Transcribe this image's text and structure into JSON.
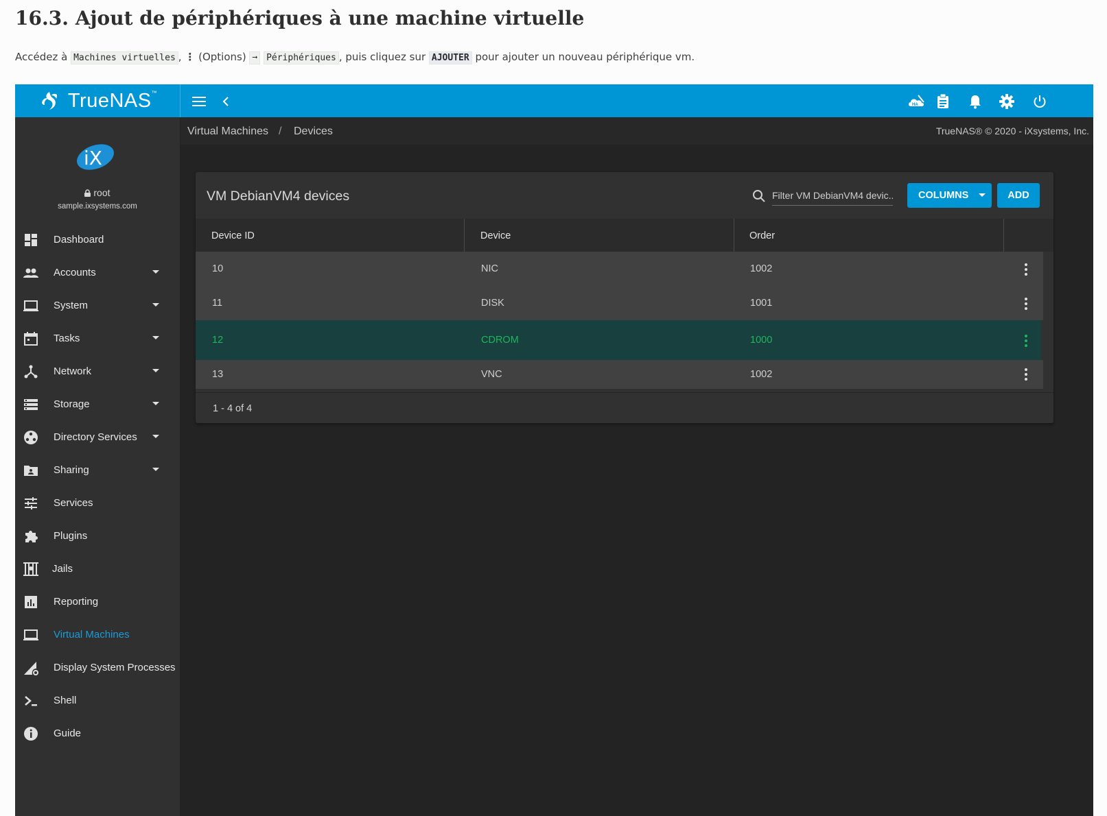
{
  "doc": {
    "heading": "16.3. Ajout de périphériques à une machine virtuelle",
    "p_prefix": "Accédez à ",
    "p_code1": "Machines virtuelles",
    "p_comma": ", ",
    "p_dots": "⋮",
    "p_options": " (Options) ",
    "p_arrow": "➞",
    "p_code2": "Périphériques",
    "p_mid": ", puis cliquez sur ",
    "p_code3": "AJOUTER",
    "p_suffix": " pour ajouter un nouveau périphérique vm."
  },
  "topbar": {
    "brand": "TrueNAS",
    "brand_tm": "™",
    "accent": "#0095d5"
  },
  "profile": {
    "user": "root",
    "host": "sample.ixsystems.com"
  },
  "nav": [
    {
      "label": "Dashboard",
      "icon": "dashboard-icon",
      "caret": false
    },
    {
      "label": "Accounts",
      "icon": "accounts-icon",
      "caret": true
    },
    {
      "label": "System",
      "icon": "system-icon",
      "caret": true
    },
    {
      "label": "Tasks",
      "icon": "tasks-icon",
      "caret": true
    },
    {
      "label": "Network",
      "icon": "network-icon",
      "caret": true
    },
    {
      "label": "Storage",
      "icon": "storage-icon",
      "caret": true
    },
    {
      "label": "Directory Services",
      "icon": "directory-services-icon",
      "caret": true
    },
    {
      "label": "Sharing",
      "icon": "sharing-icon",
      "caret": true
    },
    {
      "label": "Services",
      "icon": "services-icon",
      "caret": false
    },
    {
      "label": "Plugins",
      "icon": "plugins-icon",
      "caret": false
    },
    {
      "label": "Jails",
      "icon": "jails-icon",
      "caret": false
    },
    {
      "label": "Reporting",
      "icon": "reporting-icon",
      "caret": false
    },
    {
      "label": "Virtual Machines",
      "icon": "virtual-machines-icon",
      "caret": false,
      "active": true
    },
    {
      "label": "Display System Processes",
      "icon": "processes-icon",
      "caret": false
    },
    {
      "label": "Shell",
      "icon": "shell-icon",
      "caret": false
    },
    {
      "label": "Guide",
      "icon": "guide-icon",
      "caret": false
    }
  ],
  "breadcrumb": {
    "items": [
      "Virtual Machines",
      "Devices"
    ],
    "separator": "/",
    "copyright": "TrueNAS® © 2020 - iXsystems, Inc."
  },
  "card": {
    "title": "VM DebianVM4 devices",
    "filter_placeholder": "Filter VM DebianVM4 devic...",
    "columns_label": "COLUMNS",
    "add_label": "ADD",
    "headers": [
      "Device ID",
      "Device",
      "Order"
    ],
    "rows": [
      {
        "id": "10",
        "device": "NIC",
        "order": "1002",
        "selected": false
      },
      {
        "id": "11",
        "device": "DISK",
        "order": "1001",
        "selected": false
      },
      {
        "id": "12",
        "device": "CDROM",
        "order": "1000",
        "selected": true
      },
      {
        "id": "13",
        "device": "VNC",
        "order": "1002",
        "selected": false
      }
    ],
    "paginator": "1 - 4 of 4"
  }
}
